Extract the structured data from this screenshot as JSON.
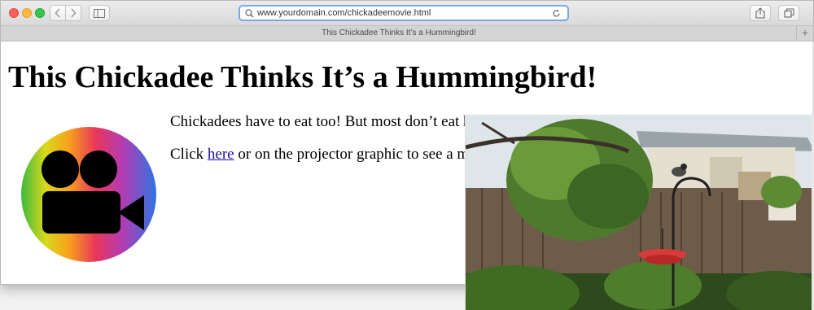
{
  "browser": {
    "url": "www.yourdomain.com/chickadeemovie.html",
    "tab_title": "This Chickadee Thinks It’s a Hummingbird!",
    "new_tab_label": "+"
  },
  "page": {
    "heading": "This Chickadee Thinks It’s a Hummingbird!",
    "paragraph1": "Chickadees have to eat too! But most don’t eat hu",
    "paragraph2_before": "Click ",
    "paragraph2_link": "here",
    "paragraph2_after": " or on the projector graphic to see a mo"
  },
  "icons": {
    "back": "chevron-left-icon",
    "forward": "chevron-right-icon",
    "sidebar": "sidebar-icon",
    "search": "search-icon",
    "reload": "reload-icon",
    "share": "share-icon",
    "tabs": "tabs-icon",
    "projector": "movie-camera-icon"
  },
  "colors": {
    "link": "#1a0dab",
    "address_focus": "#79a7e8"
  }
}
